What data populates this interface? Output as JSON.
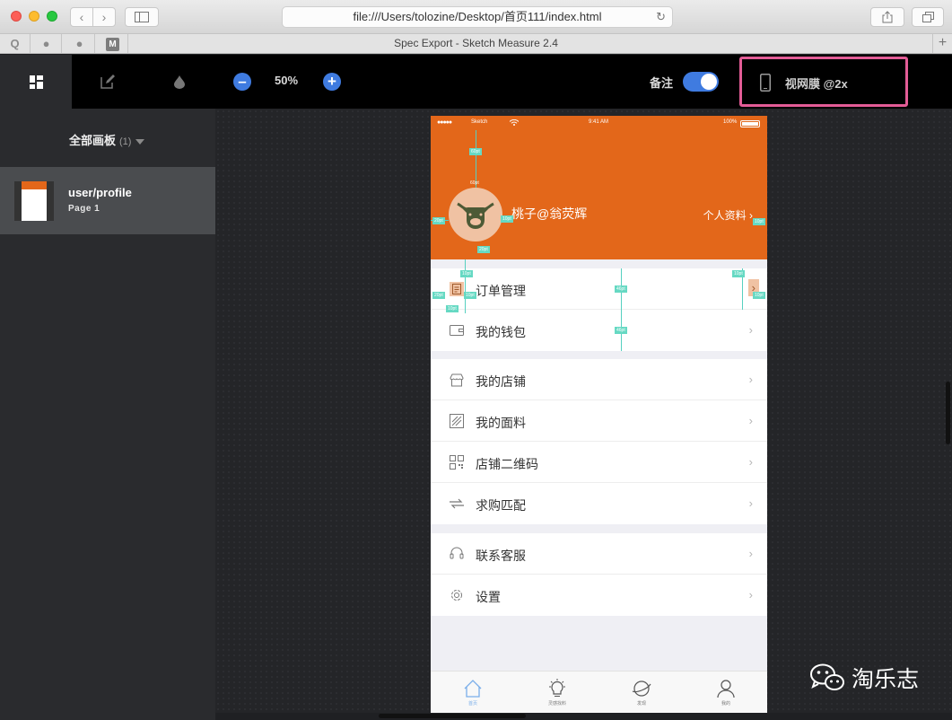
{
  "browser": {
    "address": "file:///Users/tolozine/Desktop/首页111/index.html",
    "tab_title": "Spec Export - Sketch Measure 2.4",
    "favorites": [
      "Q",
      "qq-icon",
      "qq-icon",
      "M"
    ]
  },
  "toolbar": {
    "zoom": "50%",
    "note_label": "备注",
    "note_enabled": true,
    "device_label": "视网膜 @2x"
  },
  "sidebar": {
    "header": "全部画板",
    "count": "(1)",
    "artboards": [
      {
        "name": "user/profile",
        "page": "Page 1"
      }
    ]
  },
  "phone": {
    "status": {
      "carrier": "Sketch",
      "time": "9:41 AM",
      "battery": "100%"
    },
    "username": "桃子@翁荧辉",
    "profile_link": "个人资料",
    "groups": [
      [
        {
          "label": "订单管理",
          "icon": "order-icon"
        },
        {
          "label": "我的钱包",
          "icon": "wallet-icon"
        }
      ],
      [
        {
          "label": "我的店铺",
          "icon": "shop-icon"
        },
        {
          "label": "我的面料",
          "icon": "fabric-icon"
        },
        {
          "label": "店铺二维码",
          "icon": "qrcode-icon"
        },
        {
          "label": "求购匹配",
          "icon": "match-icon"
        }
      ],
      [
        {
          "label": "联系客服",
          "icon": "service-icon"
        },
        {
          "label": "设置",
          "icon": "settings-icon"
        }
      ]
    ],
    "tabs": [
      {
        "label": "首页",
        "icon": "home-icon"
      },
      {
        "label": "灵感找料",
        "icon": "bulb-icon"
      },
      {
        "label": "发现",
        "icon": "planet-icon"
      },
      {
        "label": "我的",
        "icon": "user-icon"
      }
    ],
    "measures": [
      "60pt",
      "60pt",
      "20pt",
      "10pt",
      "20pt",
      "10pt",
      "10pt",
      "20pt",
      "10pt",
      "10pt",
      "46pt",
      "46pt",
      "46pt",
      "10pt",
      "10pt"
    ]
  },
  "watermark": "淘乐志",
  "colors": {
    "accent": "#3f7be0",
    "header": "#e3671a",
    "highlight": "#e35c96",
    "measure": "#66d9c3"
  }
}
